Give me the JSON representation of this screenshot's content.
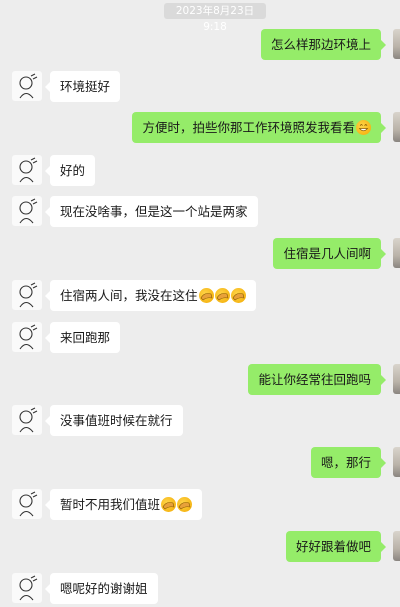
{
  "chat": {
    "timestamp": "2023年8月23日 9:18",
    "messages": [
      {
        "side": "right",
        "text": "怎么样那边环境上",
        "emojis": []
      },
      {
        "side": "left",
        "text": "环境挺好",
        "emojis": []
      },
      {
        "side": "right",
        "text": "方便时，拍些你那工作环境照发我看看",
        "emojis": [
          "grin-emoji"
        ]
      },
      {
        "side": "left",
        "text": "好的",
        "emojis": []
      },
      {
        "side": "left",
        "text": "现在没啥事，但是这一个站是两家",
        "emojis": []
      },
      {
        "side": "right",
        "text": "住宿是几人间啊",
        "emojis": []
      },
      {
        "side": "left",
        "text": "住宿两人间，我没在这住",
        "emojis": [
          "facepalm-emoji",
          "facepalm-emoji",
          "facepalm-emoji"
        ]
      },
      {
        "side": "left",
        "text": "来回跑那",
        "emojis": []
      },
      {
        "side": "right",
        "text": "能让你经常往回跑吗",
        "emojis": []
      },
      {
        "side": "left",
        "text": "没事值班时候在就行",
        "emojis": []
      },
      {
        "side": "right",
        "text": "嗯，那行",
        "emojis": []
      },
      {
        "side": "left",
        "text": "暂时不用我们值班",
        "emojis": [
          "facepalm-emoji",
          "facepalm-emoji"
        ]
      },
      {
        "side": "right",
        "text": "好好跟着做吧",
        "emojis": []
      },
      {
        "side": "left",
        "text": "嗯呢好的谢谢姐",
        "emojis": []
      }
    ]
  },
  "colors": {
    "background": "#ededed",
    "sent_bubble": "#95ec69",
    "received_bubble": "#ffffff",
    "timestamp_bg": "#dadada"
  }
}
